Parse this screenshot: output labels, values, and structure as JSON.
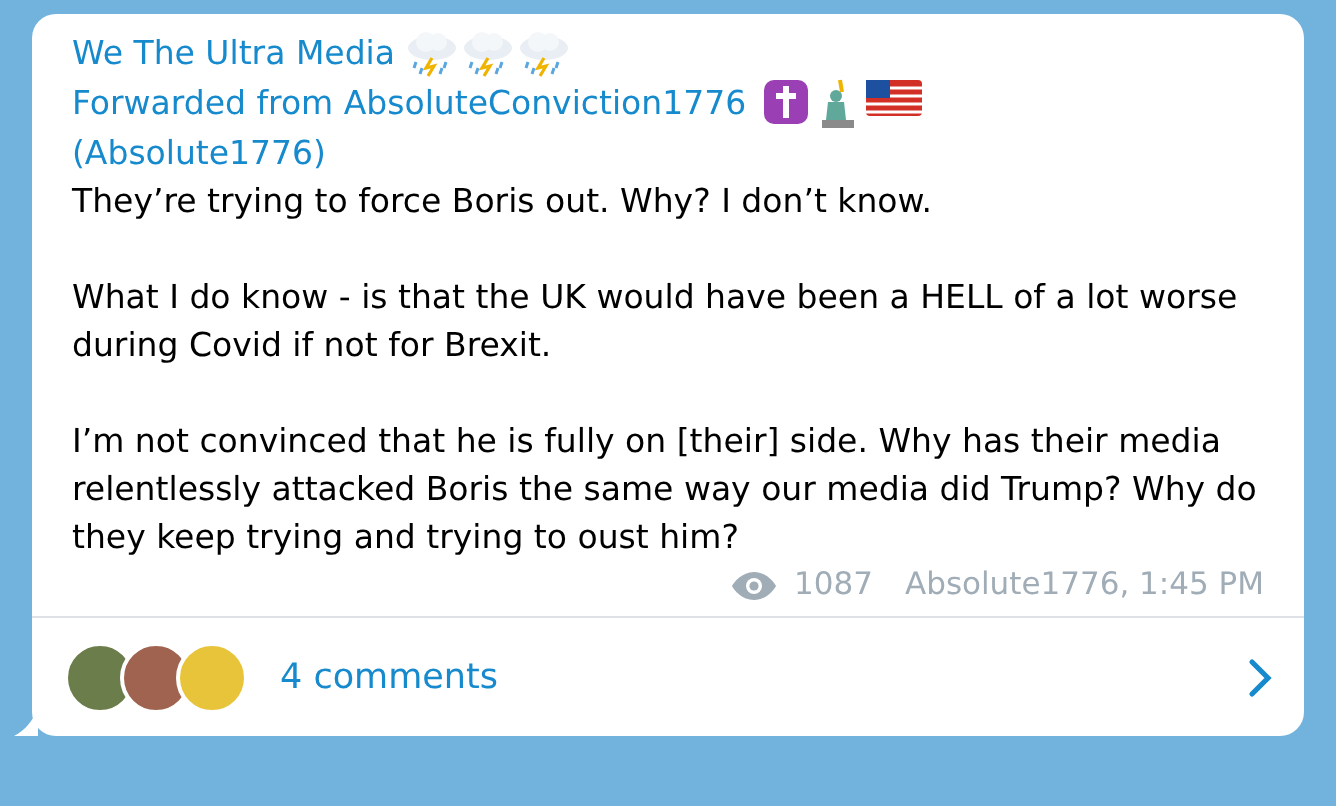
{
  "message": {
    "channel": "We The Ultra Media",
    "forwarded_from": "Forwarded from AbsoluteConviction1776",
    "forward_handle": "(Absolute1776)",
    "paragraphs": [
      "They’re trying to force Boris out. Why? I don’t know.",
      "What I do know - is that the UK would have been a HELL of a lot worse during Covid if not for Brexit.",
      "I’m not convinced that he is fully on [their] side. Why has their media relentlessly attacked Boris the same way our media did Trump? Why do they keep trying and trying to oust him?"
    ],
    "views": "1087",
    "signature": "Absolute1776, 1:45 PM"
  },
  "comments": {
    "label": "4 comments",
    "avatars": [
      {
        "color": "#6b7d4a"
      },
      {
        "color": "#a0634f"
      },
      {
        "color": "#e8c43a"
      }
    ]
  }
}
